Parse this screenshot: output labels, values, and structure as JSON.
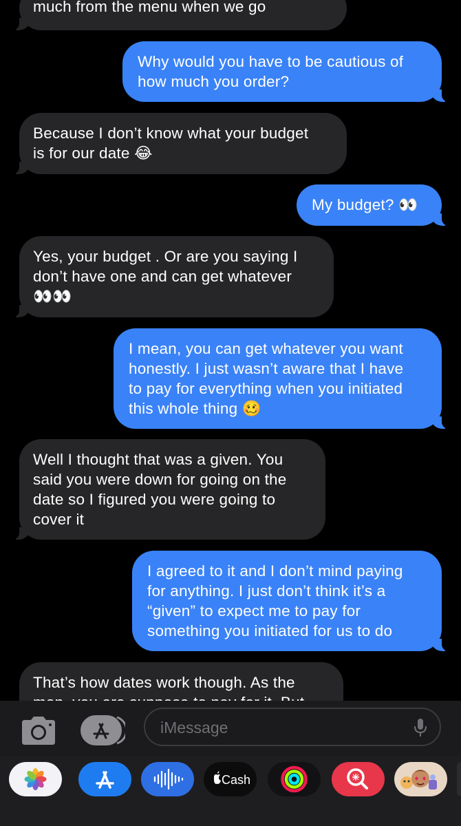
{
  "thread": {
    "messages": [
      {
        "side": "received",
        "text": "much from the menu when we go"
      },
      {
        "side": "sent",
        "text": "Why would you have to be cautious of\nhow much you order?"
      },
      {
        "side": "received",
        "text": "Because I don’t know what your budget\nis for our date 😂"
      },
      {
        "side": "sent",
        "text": "My budget? 👀"
      },
      {
        "side": "received",
        "text": "Yes, your budget . Or are you saying I\ndon’t have one and can get whatever\n👀👀"
      },
      {
        "side": "sent",
        "text": "I mean, you can get whatever you want\nhonestly. I just wasn’t aware that I have\nto pay for everything when you initiated\nthis whole thing 🥴"
      },
      {
        "side": "received",
        "text": "Well I thought that was a given. You\nsaid you were down for going on the\ndate so I figured you were going to\ncover it"
      },
      {
        "side": "sent",
        "text": "I agreed to it and I don’t mind paying\nfor anything. I just don’t think it’s a\n“given” to expect me to pay for\nsomething you initiated for us to do"
      },
      {
        "side": "received",
        "text": "That’s how dates work though. As the\nman, you are suppose to pay for it. But"
      }
    ]
  },
  "composer": {
    "placeholder": "iMessage",
    "camera_icon": "camera-icon",
    "apps_icon": "app-store-icon",
    "mic_icon": "microphone-icon"
  },
  "app_drawer": {
    "apps": [
      {
        "name": "photos-app-icon"
      },
      {
        "name": "app-store-app-icon"
      },
      {
        "name": "audio-message-app-icon"
      },
      {
        "name": "apple-cash-app-icon",
        "label": "Cash"
      },
      {
        "name": "activity-app-icon"
      },
      {
        "name": "image-search-app-icon"
      },
      {
        "name": "memoji-app-icon"
      }
    ]
  },
  "colors": {
    "background": "#000000",
    "received_bubble": "#262628",
    "sent_bubble": "#3a82f7",
    "composer_bg": "#1b1b1d",
    "drawer_bg": "#1e1e20"
  }
}
